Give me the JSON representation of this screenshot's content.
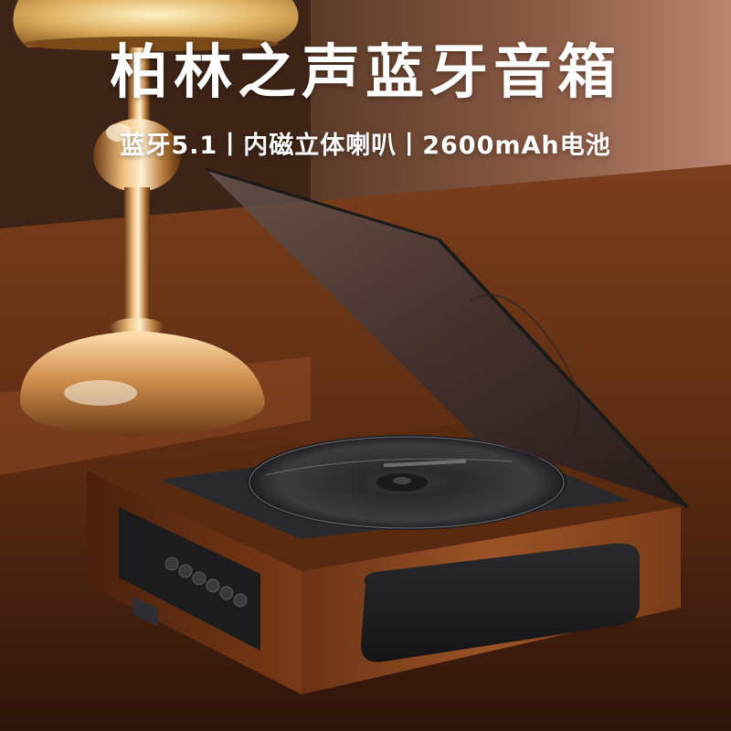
{
  "headline": {
    "title": "柏林之声蓝牙音箱",
    "subtitle": "蓝牙5.1丨内磁立体喇叭丨2600mAh电池"
  },
  "colors": {
    "headline_text": "#ffffff",
    "wood": "#8a4a22",
    "speaker_grille": "#1c1c1e",
    "lid": "#3a3a3e"
  }
}
